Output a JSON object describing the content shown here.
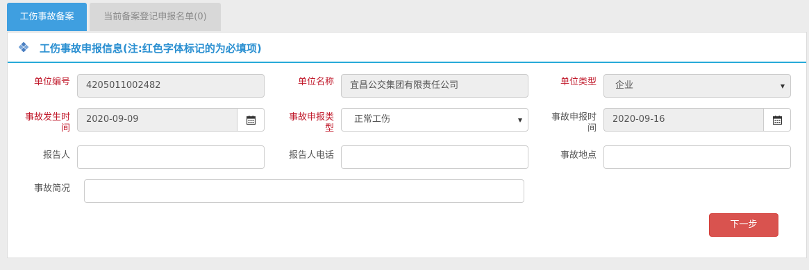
{
  "tabs": [
    {
      "label": "工伤事故备案"
    },
    {
      "label": "当前备案登记申报名单(0)"
    }
  ],
  "panel": {
    "title": "工伤事故申报信息(注:红色字体标记的为必填项)"
  },
  "form": {
    "unit_code": {
      "label": "单位编号",
      "value": "4205011002482"
    },
    "unit_name": {
      "label": "单位名称",
      "value": "宜昌公交集团有限责任公司"
    },
    "unit_type": {
      "label": "单位类型",
      "value": "企业"
    },
    "accident_time": {
      "label_1": "事故发生时",
      "label_2": "间",
      "value": "2020-09-09"
    },
    "report_type": {
      "label_1": "事故申报类",
      "label_2": "型",
      "value": "正常工伤"
    },
    "report_time": {
      "label_1": "事故申报时",
      "label_2": "间",
      "value": "2020-09-16"
    },
    "reporter": {
      "label": "报告人",
      "value": ""
    },
    "reporter_phone": {
      "label": "报告人电话",
      "value": ""
    },
    "accident_place": {
      "label": "事故地点",
      "value": ""
    },
    "accident_summary": {
      "label": "事故简况",
      "value": ""
    }
  },
  "actions": {
    "next_label": "下一步"
  },
  "colors": {
    "tab_active": "#3f9fe0",
    "title": "#2a8fd1",
    "required_label": "#c0182a",
    "next_button": "#d9534f"
  },
  "icons": [
    "diamond-bullet-icon",
    "calendar-icon",
    "caret-down-icon"
  ]
}
